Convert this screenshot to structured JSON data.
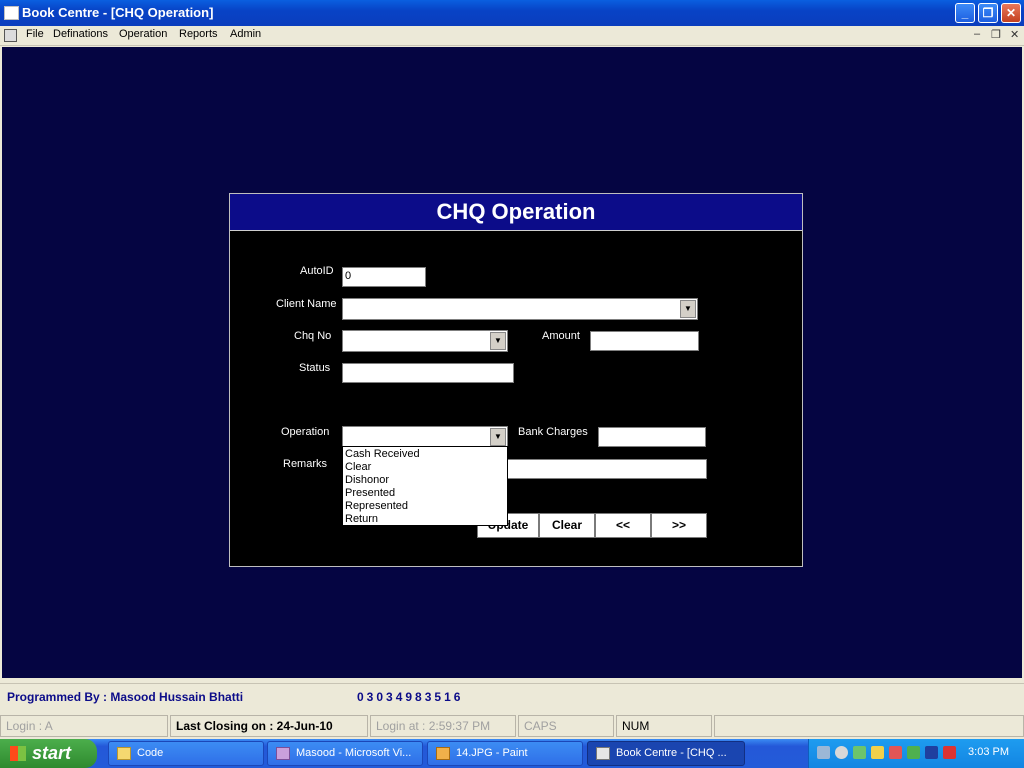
{
  "window": {
    "title": "Book Centre  - [CHQ Operation]"
  },
  "menu": {
    "items": [
      "File",
      "Definations",
      "Operation",
      "Reports",
      "Admin"
    ]
  },
  "form": {
    "title": "CHQ Operation",
    "labels": {
      "autoid": "AutoID",
      "client_name": "Client Name",
      "chq_no": "Chq No",
      "amount": "Amount",
      "status": "Status",
      "operation": "Operation",
      "bank_charges": "Bank Charges",
      "remarks": "Remarks"
    },
    "values": {
      "autoid": "0",
      "client_name": "",
      "chq_no": "",
      "amount": "",
      "status": "",
      "operation": "",
      "bank_charges": "",
      "remarks": ""
    },
    "operation_options": [
      "Cash Received",
      "Clear",
      "Dishonor",
      "Presented",
      "Represented",
      "Return"
    ],
    "buttons": {
      "update": "Update",
      "clear": "Clear",
      "prev": "<<",
      "next": ">>"
    }
  },
  "footer": {
    "programmer": "Programmed By : Masood Hussain Bhatti",
    "phone": "03034983516"
  },
  "status_bar": {
    "login": "Login :  A",
    "last_closing": "Last Closing on : 24-Jun-10",
    "login_at": "Login at : 2:59:37 PM",
    "caps": "CAPS",
    "num": "NUM"
  },
  "taskbar": {
    "start": "start",
    "tasks": [
      "Code",
      "Masood - Microsoft Vi...",
      "14.JPG - Paint",
      "Book Centre  - [CHQ ..."
    ],
    "clock": "3:03 PM"
  }
}
